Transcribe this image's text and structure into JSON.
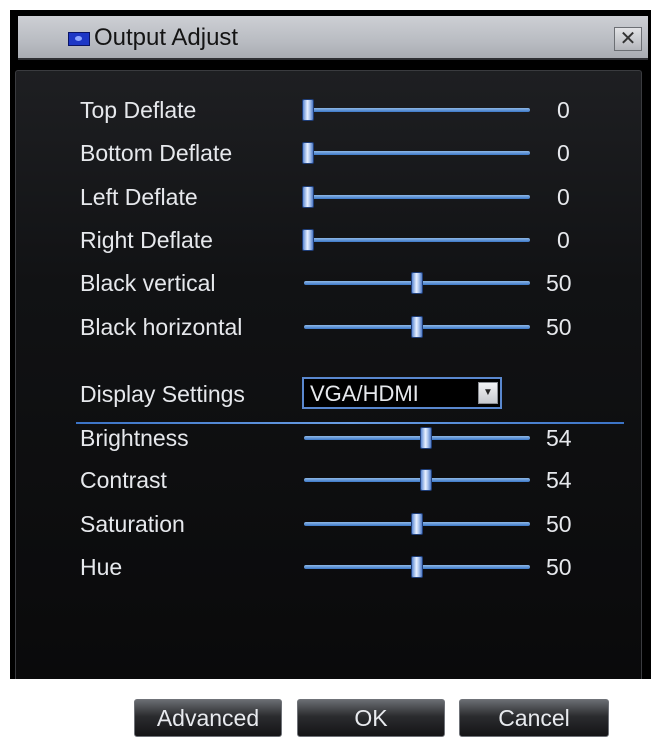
{
  "window": {
    "title": "Output Adjust",
    "close_glyph": "✕"
  },
  "sliders": [
    {
      "id": "top-deflate",
      "label": "Top Deflate",
      "value": "0",
      "fraction": 0.0
    },
    {
      "id": "bottom-deflate",
      "label": "Bottom Deflate",
      "value": "0",
      "fraction": 0.0
    },
    {
      "id": "left-deflate",
      "label": "Left Deflate",
      "value": "0",
      "fraction": 0.0
    },
    {
      "id": "right-deflate",
      "label": "Right Deflate",
      "value": "0",
      "fraction": 0.0
    },
    {
      "id": "black-vertical",
      "label": "Black vertical",
      "value": "50",
      "fraction": 0.5
    },
    {
      "id": "black-horizontal",
      "label": "Black horizontal",
      "value": "50",
      "fraction": 0.5
    },
    {
      "id": "brightness",
      "label": "Brightness",
      "value": "54",
      "fraction": 0.54
    },
    {
      "id": "contrast",
      "label": "Contrast",
      "value": "54",
      "fraction": 0.54
    },
    {
      "id": "saturation",
      "label": "Saturation",
      "value": "50",
      "fraction": 0.5
    },
    {
      "id": "hue",
      "label": "Hue",
      "value": "50",
      "fraction": 0.5
    }
  ],
  "display_settings": {
    "label": "Display Settings",
    "selected": "VGA/HDMI"
  },
  "buttons": {
    "advanced": "Advanced",
    "ok": "OK",
    "cancel": "Cancel"
  },
  "colors": {
    "accent": "#3c78c8",
    "background": "#000000",
    "text": "#e6e8ec"
  }
}
